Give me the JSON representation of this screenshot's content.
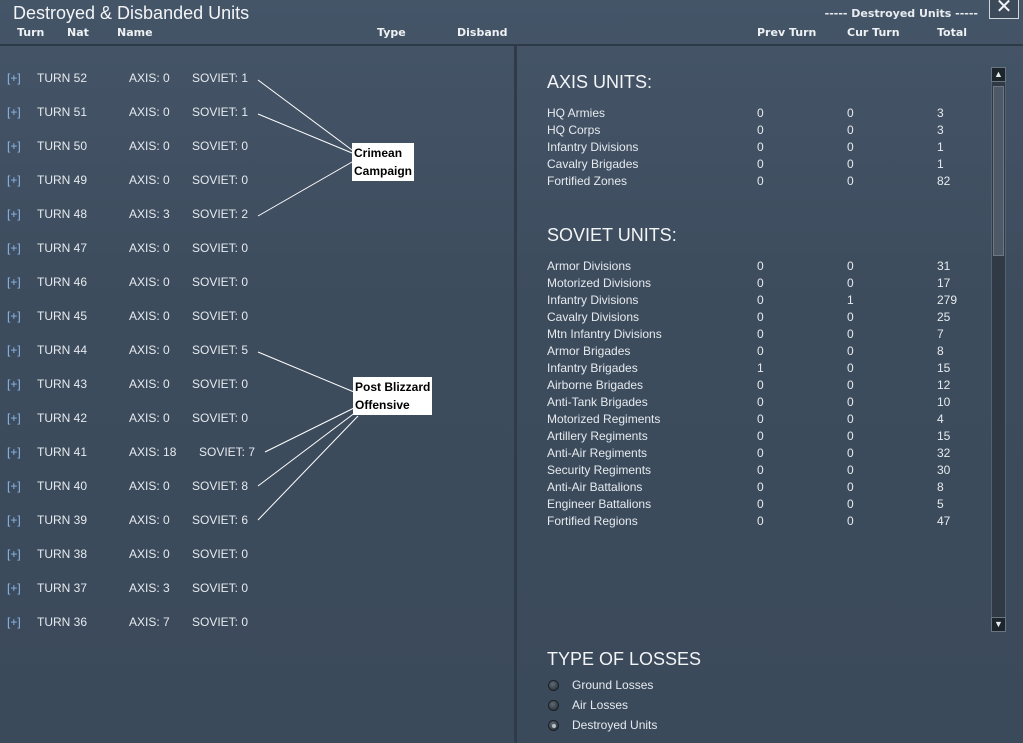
{
  "window": {
    "title": "Destroyed & Disbanded Units",
    "view_label": "----- Destroyed Units -----",
    "close_glyph": "✕"
  },
  "columns": {
    "turn": "Turn",
    "nat": "Nat",
    "name": "Name",
    "type": "Type",
    "disband": "Disband",
    "prev_turn": "Prev Turn",
    "cur_turn": "Cur Turn",
    "total": "Total"
  },
  "expand_glyph": "[+]",
  "turns": [
    {
      "turn": "TURN 52",
      "axis": "AXIS: 0",
      "soviet": "SOVIET: 1"
    },
    {
      "turn": "TURN 51",
      "axis": "AXIS: 0",
      "soviet": "SOVIET: 1"
    },
    {
      "turn": "TURN 50",
      "axis": "AXIS: 0",
      "soviet": "SOVIET: 0"
    },
    {
      "turn": "TURN 49",
      "axis": "AXIS: 0",
      "soviet": "SOVIET: 0"
    },
    {
      "turn": "TURN 48",
      "axis": "AXIS: 3",
      "soviet": "SOVIET: 2"
    },
    {
      "turn": "TURN 47",
      "axis": "AXIS: 0",
      "soviet": "SOVIET: 0"
    },
    {
      "turn": "TURN 46",
      "axis": "AXIS: 0",
      "soviet": "SOVIET: 0"
    },
    {
      "turn": "TURN 45",
      "axis": "AXIS: 0",
      "soviet": "SOVIET: 0"
    },
    {
      "turn": "TURN 44",
      "axis": "AXIS: 0",
      "soviet": "SOVIET: 5"
    },
    {
      "turn": "TURN 43",
      "axis": "AXIS: 0",
      "soviet": "SOVIET: 0"
    },
    {
      "turn": "TURN 42",
      "axis": "AXIS: 0",
      "soviet": "SOVIET: 0"
    },
    {
      "turn": "TURN 41",
      "axis": "AXIS: 18",
      "soviet": "SOVIET: 7"
    },
    {
      "turn": "TURN 40",
      "axis": "AXIS: 0",
      "soviet": "SOVIET: 8"
    },
    {
      "turn": "TURN 39",
      "axis": "AXIS: 0",
      "soviet": "SOVIET: 6"
    },
    {
      "turn": "TURN 38",
      "axis": "AXIS: 0",
      "soviet": "SOVIET: 0"
    },
    {
      "turn": "TURN 37",
      "axis": "AXIS: 3",
      "soviet": "SOVIET: 0"
    },
    {
      "turn": "TURN 36",
      "axis": "AXIS: 7",
      "soviet": "SOVIET: 0"
    }
  ],
  "callouts": {
    "crimean": {
      "line1": "Crimean",
      "line2": "Campaign"
    },
    "blizzard": {
      "line1": "Post Blizzard",
      "line2": "Offensive"
    }
  },
  "axis_units": {
    "title": "AXIS UNITS:",
    "rows": [
      {
        "name": "HQ Armies",
        "prev": "0",
        "cur": "0",
        "total": "3"
      },
      {
        "name": "HQ Corps",
        "prev": "0",
        "cur": "0",
        "total": "3"
      },
      {
        "name": "Infantry Divisions",
        "prev": "0",
        "cur": "0",
        "total": "1"
      },
      {
        "name": "Cavalry Brigades",
        "prev": "0",
        "cur": "0",
        "total": "1"
      },
      {
        "name": "Fortified Zones",
        "prev": "0",
        "cur": "0",
        "total": "82"
      }
    ]
  },
  "soviet_units": {
    "title": "SOVIET UNITS:",
    "rows": [
      {
        "name": "Armor Divisions",
        "prev": "0",
        "cur": "0",
        "total": "31"
      },
      {
        "name": "Motorized Divisions",
        "prev": "0",
        "cur": "0",
        "total": "17"
      },
      {
        "name": "Infantry Divisions",
        "prev": "0",
        "cur": "1",
        "total": "279"
      },
      {
        "name": "Cavalry Divisions",
        "prev": "0",
        "cur": "0",
        "total": "25"
      },
      {
        "name": "Mtn Infantry Divisions",
        "prev": "0",
        "cur": "0",
        "total": "7"
      },
      {
        "name": "Armor Brigades",
        "prev": "0",
        "cur": "0",
        "total": "8"
      },
      {
        "name": "Infantry Brigades",
        "prev": "1",
        "cur": "0",
        "total": "15"
      },
      {
        "name": "Airborne Brigades",
        "prev": "0",
        "cur": "0",
        "total": "12"
      },
      {
        "name": "Anti-Tank Brigades",
        "prev": "0",
        "cur": "0",
        "total": "10"
      },
      {
        "name": "Motorized Regiments",
        "prev": "0",
        "cur": "0",
        "total": "4"
      },
      {
        "name": "Artillery Regiments",
        "prev": "0",
        "cur": "0",
        "total": "15"
      },
      {
        "name": "Anti-Air Regiments",
        "prev": "0",
        "cur": "0",
        "total": "32"
      },
      {
        "name": "Security Regiments",
        "prev": "0",
        "cur": "0",
        "total": "30"
      },
      {
        "name": "Anti-Air Battalions",
        "prev": "0",
        "cur": "0",
        "total": "8"
      },
      {
        "name": "Engineer Battalions",
        "prev": "0",
        "cur": "0",
        "total": "5"
      },
      {
        "name": "Fortified Regions",
        "prev": "0",
        "cur": "0",
        "total": "47"
      }
    ]
  },
  "scrollbar": {
    "up_glyph": "▲",
    "down_glyph": "▼"
  },
  "loss_types": {
    "title": "TYPE OF LOSSES",
    "options": [
      {
        "label": "Ground Losses",
        "selected": false
      },
      {
        "label": "Air Losses",
        "selected": false
      },
      {
        "label": "Destroyed Units",
        "selected": true
      }
    ]
  }
}
